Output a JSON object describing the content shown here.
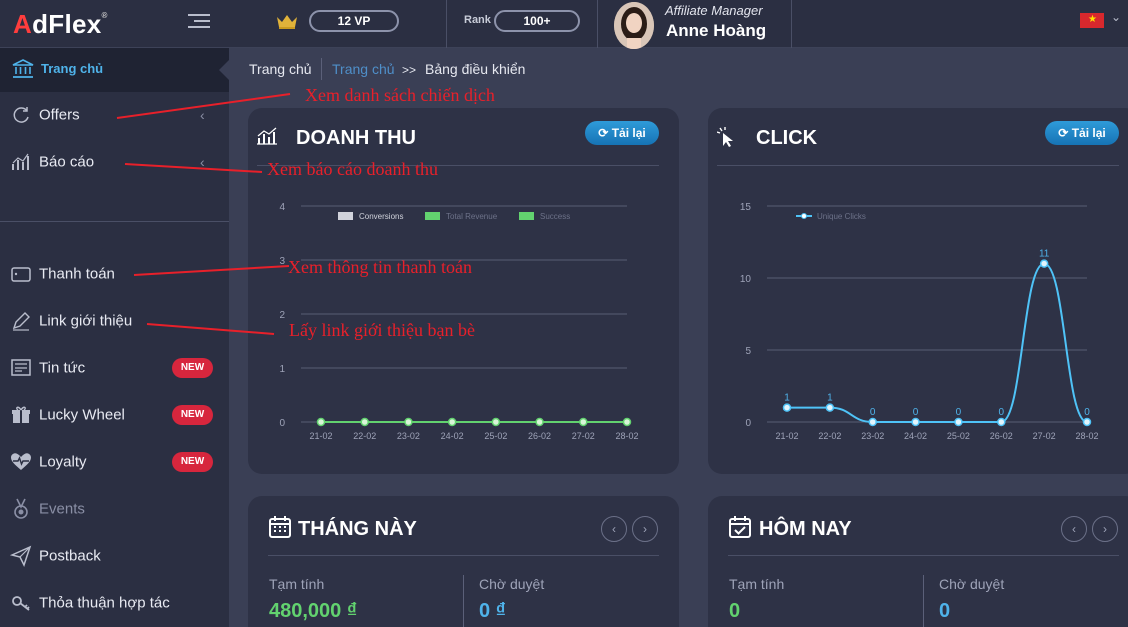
{
  "topbar": {
    "logo": {
      "prefix": "A",
      "rest": "dFlex",
      "mark": "®"
    },
    "vip_level": "12 VP",
    "rank_label": "Rank",
    "rank_value": "100+",
    "manager_role": "Affiliate Manager",
    "manager_name": "Anne Hoàng",
    "language_flag": "vietnam-flag-icon"
  },
  "sidebar": {
    "home": "Trang chủ",
    "items": [
      {
        "label": "Offers"
      },
      {
        "label": "Báo cáo"
      },
      {
        "label": "Thanh toán"
      },
      {
        "label": "Link giới thiệu"
      },
      {
        "label": "Tin tức",
        "badge": "NEW"
      },
      {
        "label": "Lucky Wheel",
        "badge": "NEW"
      },
      {
        "label": "Loyalty",
        "badge": "NEW"
      },
      {
        "label": "Events"
      },
      {
        "label": "Postback"
      },
      {
        "label": "Thỏa thuận hợp tác"
      }
    ]
  },
  "breadcrumb": {
    "first": "Trang chủ",
    "second": "Trang chủ",
    "arrow": ">>",
    "current": "Bảng điều khiển"
  },
  "annotations": {
    "offers": "Xem danh sách chiến dịch",
    "reports": "Xem báo cáo doanh thu",
    "payments": "Xem thông tin thanh toán",
    "referral": "Lấy link giới thiệu bạn bè"
  },
  "revenue_card": {
    "title": "DOANH THU",
    "reload": "Tải lại"
  },
  "click_card": {
    "title": "CLICK",
    "reload": "Tải lại"
  },
  "month_card": {
    "title": "THÁNG NÀY",
    "estimate_label": "Tạm tính",
    "estimate_value": "480,000 ₫",
    "pending_label": "Chờ duyệt",
    "pending_value": "0 ₫"
  },
  "today_card": {
    "title": "HÔM NAY",
    "estimate_label": "Tạm tính",
    "estimate_value": "0",
    "pending_label": "Chờ duyệt",
    "pending_value": "0"
  },
  "colors": {
    "accent_blue": "#2f9bd9",
    "green": "#62d26f",
    "badge_red": "#d7263d",
    "annotation_red": "#e8202a",
    "line_blue": "#4fc3f7"
  },
  "chart_data": [
    {
      "type": "line",
      "x": [
        "21-02",
        "22-02",
        "23-02",
        "24-02",
        "25-02",
        "26-02",
        "27-02",
        "28-02"
      ],
      "yticks": [
        0,
        1,
        2,
        3,
        4
      ],
      "ylim": [
        0,
        4
      ],
      "legend": [
        "Conversions",
        "Total Revenue",
        "Success"
      ],
      "legend_colors": [
        "#d0d2db",
        "#62d26f",
        "#62d26f"
      ],
      "series": [
        {
          "name": "Conversions",
          "values": [
            0,
            0,
            0,
            0,
            0,
            0,
            0,
            0
          ]
        }
      ],
      "grid": true
    },
    {
      "type": "line",
      "x": [
        "21-02",
        "22-02",
        "23-02",
        "24-02",
        "25-02",
        "26-02",
        "27-02",
        "28-02"
      ],
      "yticks": [
        0,
        5,
        10,
        15
      ],
      "ylim": [
        0,
        15
      ],
      "legend": [
        "Unique Clicks"
      ],
      "series": [
        {
          "name": "Unique Clicks",
          "values": [
            1,
            1,
            0,
            0,
            0,
            0,
            11,
            0
          ]
        }
      ],
      "data_labels": true,
      "grid": true
    }
  ]
}
